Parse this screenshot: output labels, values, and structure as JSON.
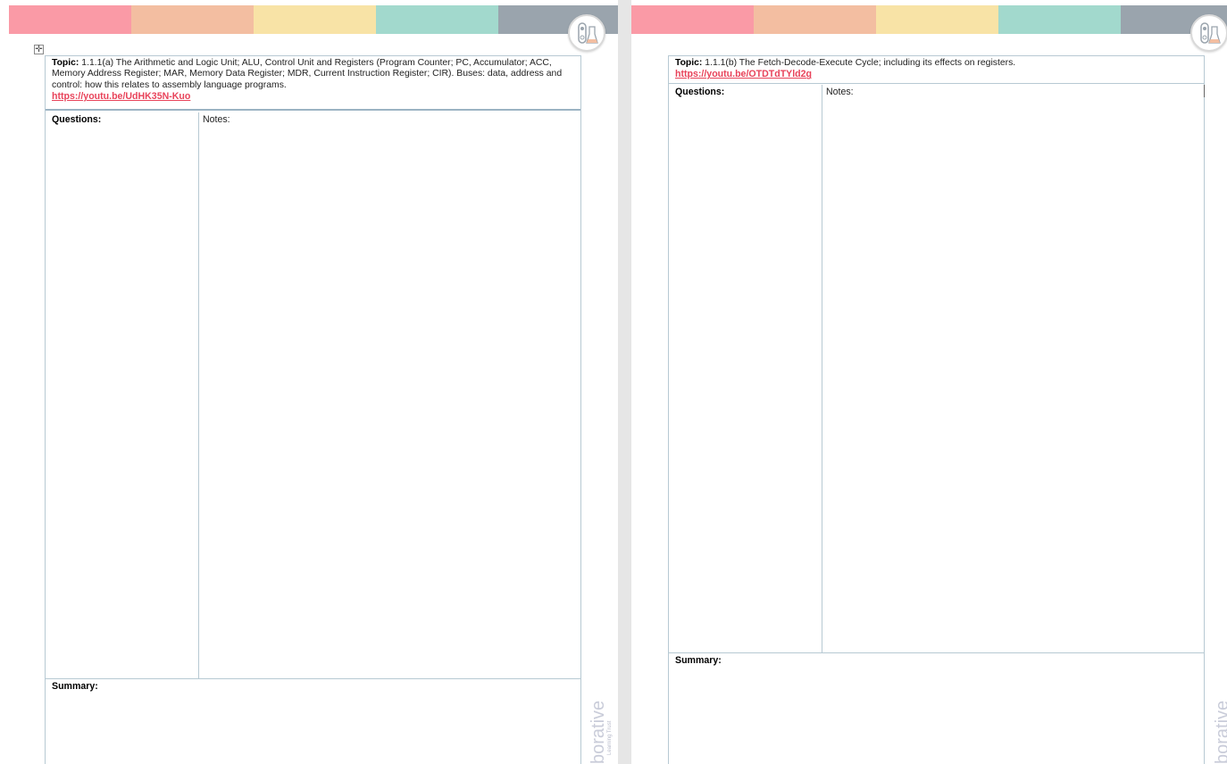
{
  "colors": {
    "band": [
      "#fa9aa6",
      "#f3bea1",
      "#f8e3a6",
      "#a2d9cd",
      "#9aa4ad"
    ],
    "link": "#e8435a",
    "border": "#b7c9d3"
  },
  "handle_symbol": "✛",
  "left_page": {
    "topic_label": "Topic:",
    "topic_text": " 1.1.1(a) The Arithmetic and Logic Unit; ALU, Control Unit and Registers (Program Counter; PC, Accumulator; ACC, Memory Address Register; MAR, Memory Data Register; MDR, Current Instruction Register; CIR). Buses: data, address and control: how this relates to assembly language programs.",
    "link_text": "https://youtu.be/UdHK35N-Kuo",
    "questions_label": "Questions:",
    "notes_label": "Notes:",
    "summary_label": "Summary:",
    "watermark": "borative",
    "watermark_sub": "Learning Trust"
  },
  "right_page": {
    "topic_label": "Topic:",
    "topic_text": " 1.1.1(b) The Fetch-Decode-Execute Cycle; including its effects on registers.",
    "link_text": "https://youtu.be/OTDTdTYld2g",
    "questions_label": "Questions:",
    "notes_label": "Notes:",
    "summary_label": "Summary:",
    "watermark": "borative"
  }
}
